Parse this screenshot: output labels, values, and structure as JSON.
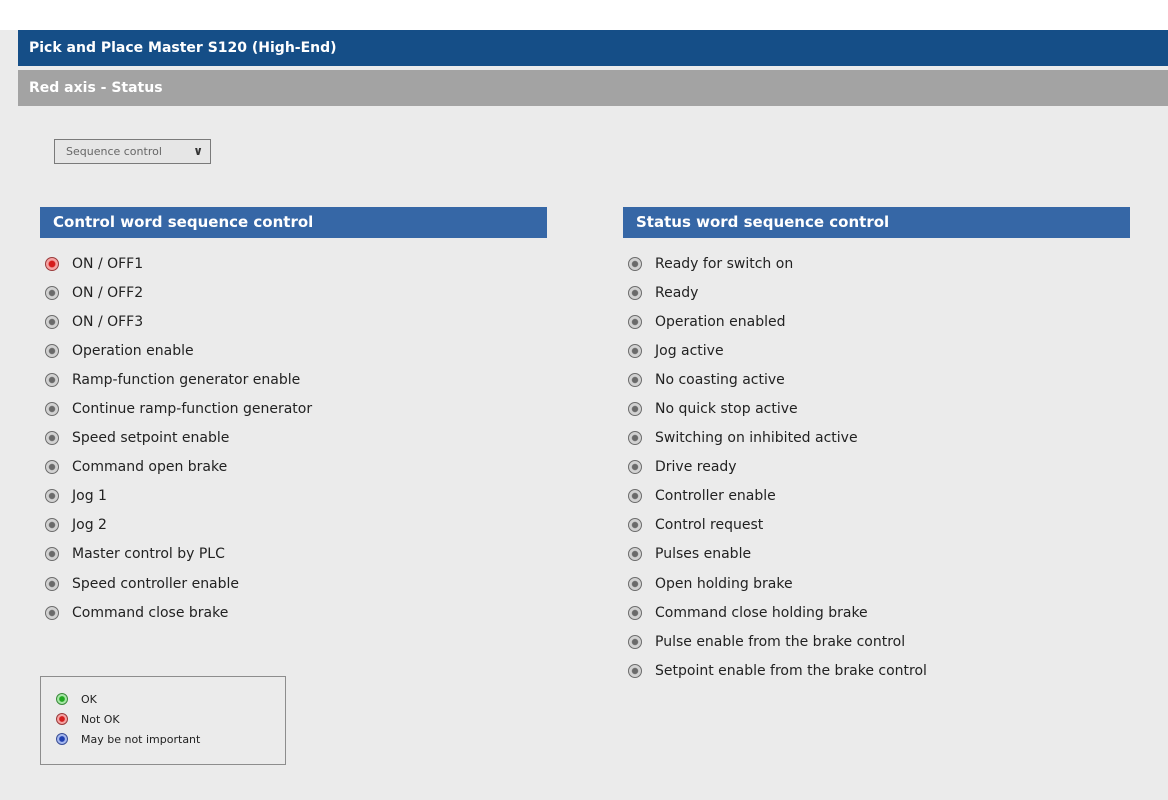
{
  "header": {
    "title": "Pick and Place Master S120 (High-End)",
    "subtitle": "Red axis - Status"
  },
  "view_select": {
    "selected": "Sequence control",
    "icon": "chevron-down-icon"
  },
  "control_word": {
    "title": "Control word sequence control",
    "items": [
      {
        "label": "ON / OFF1",
        "state": "red"
      },
      {
        "label": "ON / OFF2",
        "state": "gray"
      },
      {
        "label": "ON / OFF3",
        "state": "gray"
      },
      {
        "label": "Operation enable",
        "state": "gray"
      },
      {
        "label": "Ramp-function generator enable",
        "state": "gray"
      },
      {
        "label": "Continue ramp-function generator",
        "state": "gray"
      },
      {
        "label": "Speed setpoint enable",
        "state": "gray"
      },
      {
        "label": "Command open brake",
        "state": "gray"
      },
      {
        "label": "Jog 1",
        "state": "gray"
      },
      {
        "label": "Jog 2",
        "state": "gray"
      },
      {
        "label": "Master control by PLC",
        "state": "gray"
      },
      {
        "label": "Speed controller enable",
        "state": "gray"
      },
      {
        "label": "Command close brake",
        "state": "gray"
      }
    ]
  },
  "status_word": {
    "title": "Status word sequence control",
    "items": [
      {
        "label": "Ready for switch on",
        "state": "gray"
      },
      {
        "label": "Ready",
        "state": "gray"
      },
      {
        "label": "Operation enabled",
        "state": "gray"
      },
      {
        "label": "Jog active",
        "state": "gray"
      },
      {
        "label": "No coasting active",
        "state": "gray"
      },
      {
        "label": "No quick stop active",
        "state": "gray"
      },
      {
        "label": "Switching on inhibited active",
        "state": "gray"
      },
      {
        "label": "Drive ready",
        "state": "gray"
      },
      {
        "label": "Controller enable",
        "state": "gray"
      },
      {
        "label": "Control request",
        "state": "gray"
      },
      {
        "label": "Pulses enable",
        "state": "gray"
      },
      {
        "label": "Open holding brake",
        "state": "gray"
      },
      {
        "label": "Command close holding brake",
        "state": "gray"
      },
      {
        "label": "Pulse enable from the brake control",
        "state": "gray"
      },
      {
        "label": "Setpoint enable from the brake control",
        "state": "gray"
      }
    ]
  },
  "legend": {
    "items": [
      {
        "label": "OK",
        "state": "green"
      },
      {
        "label": "Not OK",
        "state": "red"
      },
      {
        "label": "May be not important",
        "state": "blue"
      }
    ]
  },
  "colors": {
    "title_bar": "#154e87",
    "sub_bar": "#a3a3a3",
    "section_header": "#3667a6",
    "background": "#ebebeb"
  }
}
